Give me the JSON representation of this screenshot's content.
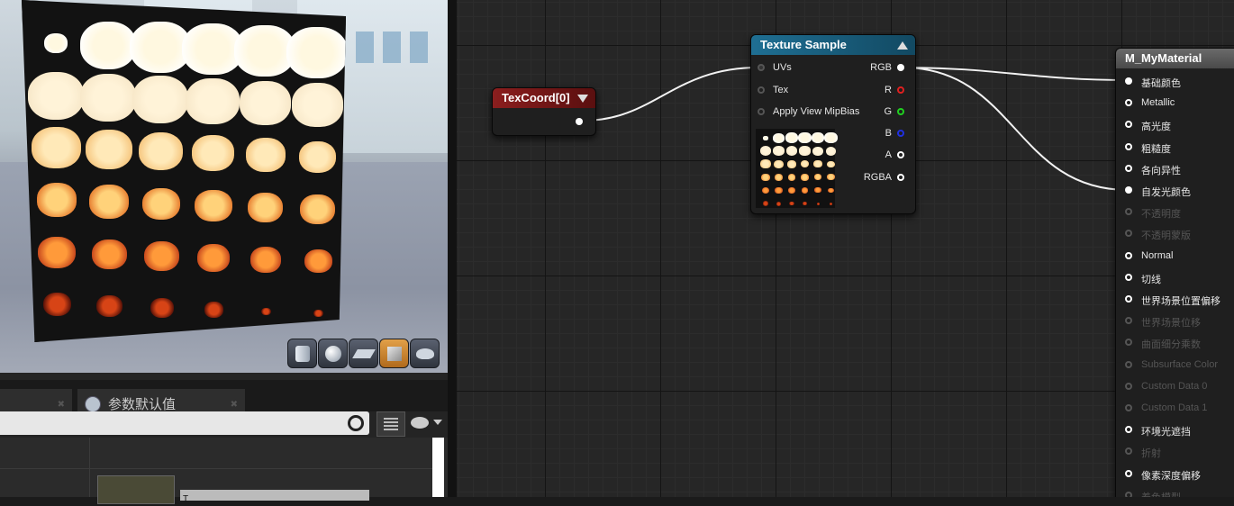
{
  "viewport": {
    "toolbar_buttons": [
      {
        "name": "cylinder-preview-button",
        "icon": "cylinder-icon"
      },
      {
        "name": "sphere-preview-button",
        "icon": "sphere-icon"
      },
      {
        "name": "plane-preview-button",
        "icon": "plane-icon"
      },
      {
        "name": "cube-preview-button",
        "icon": "cube-icon",
        "active": true
      },
      {
        "name": "custom-mesh-preview-button",
        "icon": "teapot-icon"
      }
    ]
  },
  "bottom_panel": {
    "tab_label": "参数默认值",
    "search_placeholder": "",
    "texture_field": "T"
  },
  "graph": {
    "texcoord_node": {
      "title": "TexCoord[0]"
    },
    "texture_sample_node": {
      "title": "Texture Sample",
      "inputs": [
        "UVs",
        "Tex",
        "Apply View MipBias"
      ],
      "outputs": [
        "RGB",
        "R",
        "G",
        "B",
        "A",
        "RGBA"
      ],
      "output_colors": {
        "RGB": "#ffffff",
        "R": "#e02020",
        "G": "#20d020",
        "B": "#2030e0",
        "A": "#ffffff",
        "RGBA": "#ffffff"
      }
    },
    "material_node": {
      "title": "M_MyMaterial",
      "inputs": [
        {
          "label": "基础颜色",
          "state": "connected"
        },
        {
          "label": "Metallic",
          "state": "enabled"
        },
        {
          "label": "高光度",
          "state": "enabled"
        },
        {
          "label": "粗糙度",
          "state": "enabled"
        },
        {
          "label": "各向异性",
          "state": "enabled"
        },
        {
          "label": "自发光颜色",
          "state": "connected"
        },
        {
          "label": "不透明度",
          "state": "disabled"
        },
        {
          "label": "不透明蒙版",
          "state": "disabled"
        },
        {
          "label": "Normal",
          "state": "enabled"
        },
        {
          "label": "切线",
          "state": "enabled"
        },
        {
          "label": "世界场景位置偏移",
          "state": "enabled"
        },
        {
          "label": "世界场景位移",
          "state": "disabled"
        },
        {
          "label": "曲面细分乘数",
          "state": "disabled"
        },
        {
          "label": "Subsurface Color",
          "state": "disabled"
        },
        {
          "label": "Custom Data 0",
          "state": "disabled"
        },
        {
          "label": "Custom Data 1",
          "state": "disabled"
        },
        {
          "label": "环境光遮挡",
          "state": "enabled"
        },
        {
          "label": "折射",
          "state": "disabled"
        },
        {
          "label": "像素深度偏移",
          "state": "enabled"
        },
        {
          "label": "着色模型",
          "state": "disabled"
        }
      ]
    }
  }
}
